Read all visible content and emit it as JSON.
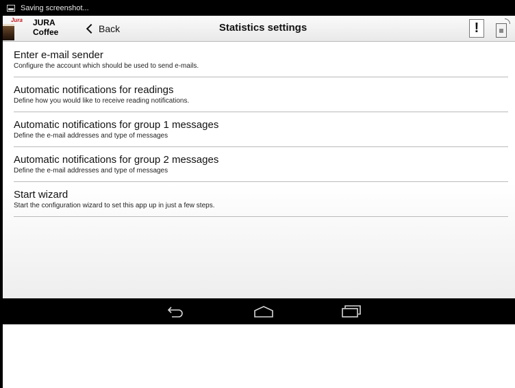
{
  "status_bar": {
    "text": "Saving screenshot...",
    "icon": "screenshot-icon"
  },
  "action_bar": {
    "app_name_line1": "JURA",
    "app_name_line2": "Coffee",
    "back_label": "Back",
    "title": "Statistics settings",
    "warning_glyph": "!",
    "icons": [
      "jura-logo-icon",
      "chevron-left-icon",
      "warning-icon",
      "coffee-machine-icon"
    ]
  },
  "settings": {
    "items": [
      {
        "title": "Enter e-mail sender",
        "subtitle": "Configure the account which should be used to send e-mails."
      },
      {
        "title": "Automatic notifications for readings",
        "subtitle": "Define how you would like to receive reading notifications."
      },
      {
        "title": "Automatic notifications for group 1 messages",
        "subtitle": "Define the e-mail addresses and type of messages"
      },
      {
        "title": "Automatic notifications for group 2 messages",
        "subtitle": "Define the e-mail addresses and type of messages"
      },
      {
        "title": "Start wizard",
        "subtitle": "Start the configuration wizard to set this app up in just a few steps."
      }
    ]
  },
  "nav_bar": {
    "icons": [
      "back-arrow-icon",
      "home-icon",
      "recent-apps-icon"
    ]
  },
  "colors": {
    "status_bar": "#000000",
    "action_bar": "#eeeeee",
    "divider": "#b9b9b9",
    "brand_red": "#c4161c"
  }
}
